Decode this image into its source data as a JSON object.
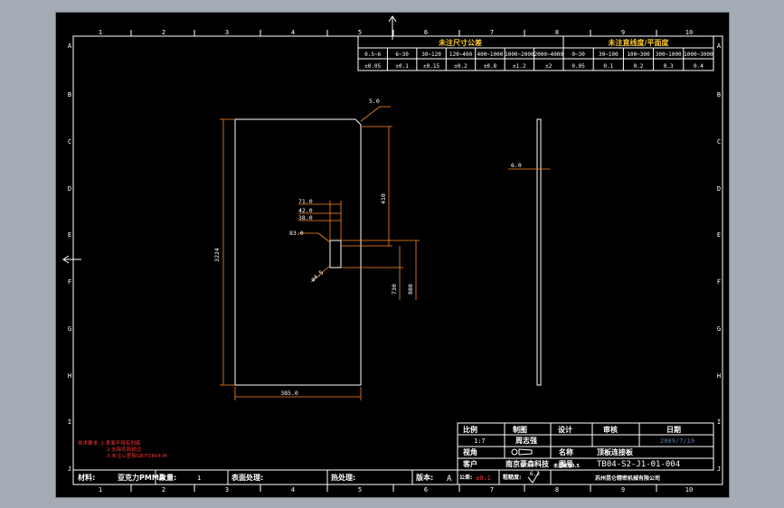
{
  "grid": {
    "columns": [
      "1",
      "2",
      "3",
      "4",
      "5",
      "6",
      "7",
      "8",
      "9",
      "10"
    ],
    "rows": [
      "A",
      "B",
      "C",
      "D",
      "E",
      "F",
      "G",
      "H",
      "I",
      "J"
    ]
  },
  "tolerance_table": {
    "title_left": "未注尺寸公差",
    "title_right": "未注直线度/平面度",
    "ranges_left": [
      "0.5~6",
      "6~30",
      "30~120",
      "120~400",
      "400~1000",
      "1000~2000",
      "2000~4000"
    ],
    "values_left": [
      "±0.05",
      "±0.1",
      "±0.15",
      "±0.2",
      "±0.8",
      "±1.2",
      "±2"
    ],
    "ranges_right": [
      "0~30",
      "30~100",
      "100~300",
      "300~1000",
      "1000~3000"
    ],
    "values_right": [
      "0.05",
      "0.1",
      "0.2",
      "0.3",
      "0.4"
    ]
  },
  "dimensions": {
    "height": "3224",
    "width": "385.0",
    "chamfer": "5.0",
    "d410": "410",
    "d730": "730",
    "d880": "880",
    "d710": "71.0",
    "d420": "42.0",
    "d380": "38.0",
    "d830": "83.0",
    "hole": "ø4.5",
    "thickness": "6.0"
  },
  "notes": {
    "lines": [
      "技术要求: 1.表面不得有划痕",
      "2.去除毛刺锐边",
      "3.未注公差按GB/T1804-M"
    ]
  },
  "title_block": {
    "scale_label": "比例",
    "scale_value": "1:7",
    "drawn_label": "制图",
    "drawn_value": "周志强",
    "design_label": "设计",
    "review_label": "审核",
    "date_label": "日期",
    "date_value": "2009/7/19",
    "view_label": "视角",
    "name_label": "名称",
    "name_value": "顶板连接板",
    "customer_label": "客户",
    "customer_value": "南京豪森科技",
    "drawing_no_label": "图号",
    "drawing_no_value": "TB04-S2-J1-01-004",
    "company": "苏州昆仑精密机械有限公司",
    "material_label": "材料:",
    "material_value": "亚克力PMMA",
    "qty_label": "数量:",
    "qty_value": "1",
    "surface_label": "表面处理:",
    "heat_label": "热处理:",
    "version_label": "版本:",
    "version_value": "A",
    "tol_label": "公差:",
    "tol_value": "±0.1",
    "rough_label": "粗糙度:",
    "rough_value": "6.3",
    "unit_note": "未注倒角0.5"
  }
}
